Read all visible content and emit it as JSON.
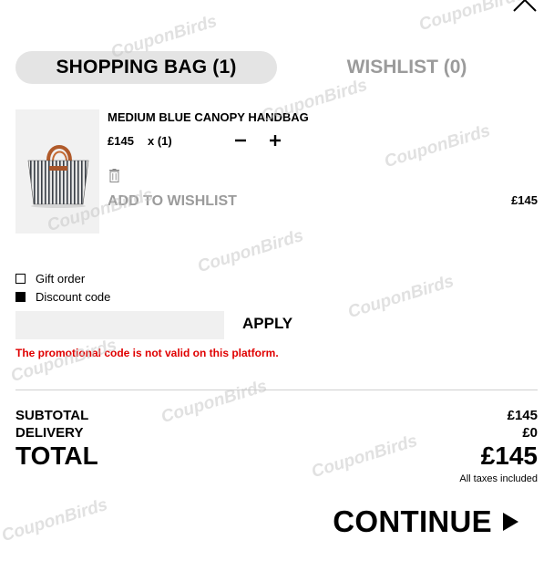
{
  "tabs": {
    "bag_label": "SHOPPING BAG (1)",
    "wishlist_label": "WISHLIST (0)"
  },
  "product": {
    "name": "MEDIUM BLUE CANOPY HANDBAG",
    "price": "£145",
    "quantity": "x (1)",
    "decrease_label": "−",
    "increase_label": "+",
    "add_to_wishlist": "ADD TO WISHLIST",
    "line_total": "£145"
  },
  "options": {
    "gift_order": "Gift order",
    "gift_order_checked": false,
    "discount_code": "Discount code",
    "discount_code_checked": true
  },
  "promo": {
    "input_value": "",
    "input_placeholder": "",
    "apply_label": "APPLY",
    "error_message": "The promotional code is not valid on this platform."
  },
  "summary": {
    "subtotal_label": "SUBTOTAL",
    "subtotal_value": "£145",
    "delivery_label": "DELIVERY",
    "delivery_value": "£0",
    "total_label": "TOTAL",
    "total_value": "£145",
    "taxes_note": "All taxes included"
  },
  "cta": {
    "continue_label": "CONTINUE"
  },
  "watermark": "CouponBirds",
  "colors": {
    "error": "#e00000",
    "muted": "#9b9b9b",
    "tab_active_bg": "#e4e4e4"
  },
  "icons": [
    "close-icon",
    "minus-icon",
    "plus-icon",
    "trash-icon",
    "play-icon"
  ]
}
